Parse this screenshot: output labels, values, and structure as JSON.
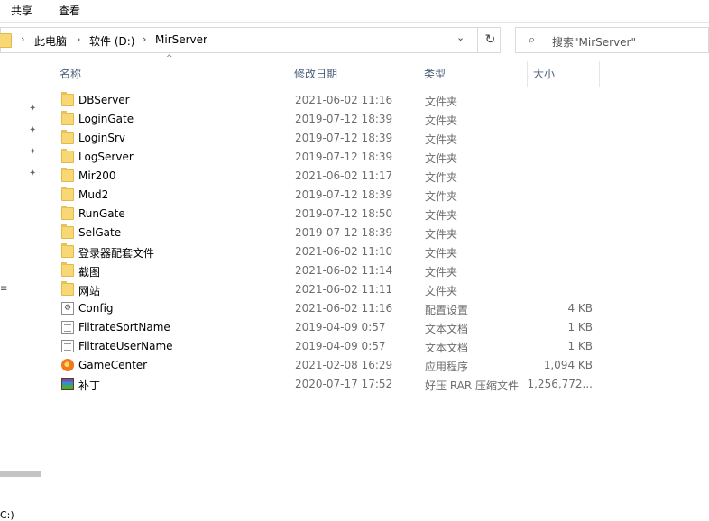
{
  "ribbon": {
    "tabs": [
      "共享",
      "查看"
    ]
  },
  "address": {
    "crumbs": [
      "此电脑",
      "软件 (D:)",
      "MirServer"
    ],
    "separator": "›",
    "dropdown_glyph": "⌄",
    "refresh_glyph": "↻"
  },
  "search": {
    "placeholder": "搜索\"MirServer\"",
    "icon": "search-icon"
  },
  "columns": {
    "name": "名称",
    "date": "修改日期",
    "type": "类型",
    "size": "大小"
  },
  "navpane": {
    "edge_text_1": "≡",
    "edge_text_2": "C:)"
  },
  "files": [
    {
      "name": "DBServer",
      "date": "2021-06-02 11:16",
      "type": "文件夹",
      "size": "",
      "icon": "folder"
    },
    {
      "name": "LoginGate",
      "date": "2019-07-12 18:39",
      "type": "文件夹",
      "size": "",
      "icon": "folder"
    },
    {
      "name": "LoginSrv",
      "date": "2019-07-12 18:39",
      "type": "文件夹",
      "size": "",
      "icon": "folder"
    },
    {
      "name": "LogServer",
      "date": "2019-07-12 18:39",
      "type": "文件夹",
      "size": "",
      "icon": "folder"
    },
    {
      "name": "Mir200",
      "date": "2021-06-02 11:17",
      "type": "文件夹",
      "size": "",
      "icon": "folder"
    },
    {
      "name": "Mud2",
      "date": "2019-07-12 18:39",
      "type": "文件夹",
      "size": "",
      "icon": "folder"
    },
    {
      "name": "RunGate",
      "date": "2019-07-12 18:50",
      "type": "文件夹",
      "size": "",
      "icon": "folder"
    },
    {
      "name": "SelGate",
      "date": "2019-07-12 18:39",
      "type": "文件夹",
      "size": "",
      "icon": "folder"
    },
    {
      "name": "登录器配套文件",
      "date": "2021-06-02 11:10",
      "type": "文件夹",
      "size": "",
      "icon": "folder"
    },
    {
      "name": "截图",
      "date": "2021-06-02 11:14",
      "type": "文件夹",
      "size": "",
      "icon": "folder"
    },
    {
      "name": "网站",
      "date": "2021-06-02 11:11",
      "type": "文件夹",
      "size": "",
      "icon": "folder"
    },
    {
      "name": "Config",
      "date": "2021-06-02 11:16",
      "type": "配置设置",
      "size": "4 KB",
      "icon": "cfg"
    },
    {
      "name": "FiltrateSortName",
      "date": "2019-04-09 0:57",
      "type": "文本文档",
      "size": "1 KB",
      "icon": "doc"
    },
    {
      "name": "FiltrateUserName",
      "date": "2019-04-09 0:57",
      "type": "文本文档",
      "size": "1 KB",
      "icon": "doc"
    },
    {
      "name": "GameCenter",
      "date": "2021-02-08 16:29",
      "type": "应用程序",
      "size": "1,094 KB",
      "icon": "game"
    },
    {
      "name": "补丁",
      "date": "2020-07-17 17:52",
      "type": "好压 RAR 压缩文件",
      "size": "1,256,772...",
      "icon": "rar"
    }
  ]
}
